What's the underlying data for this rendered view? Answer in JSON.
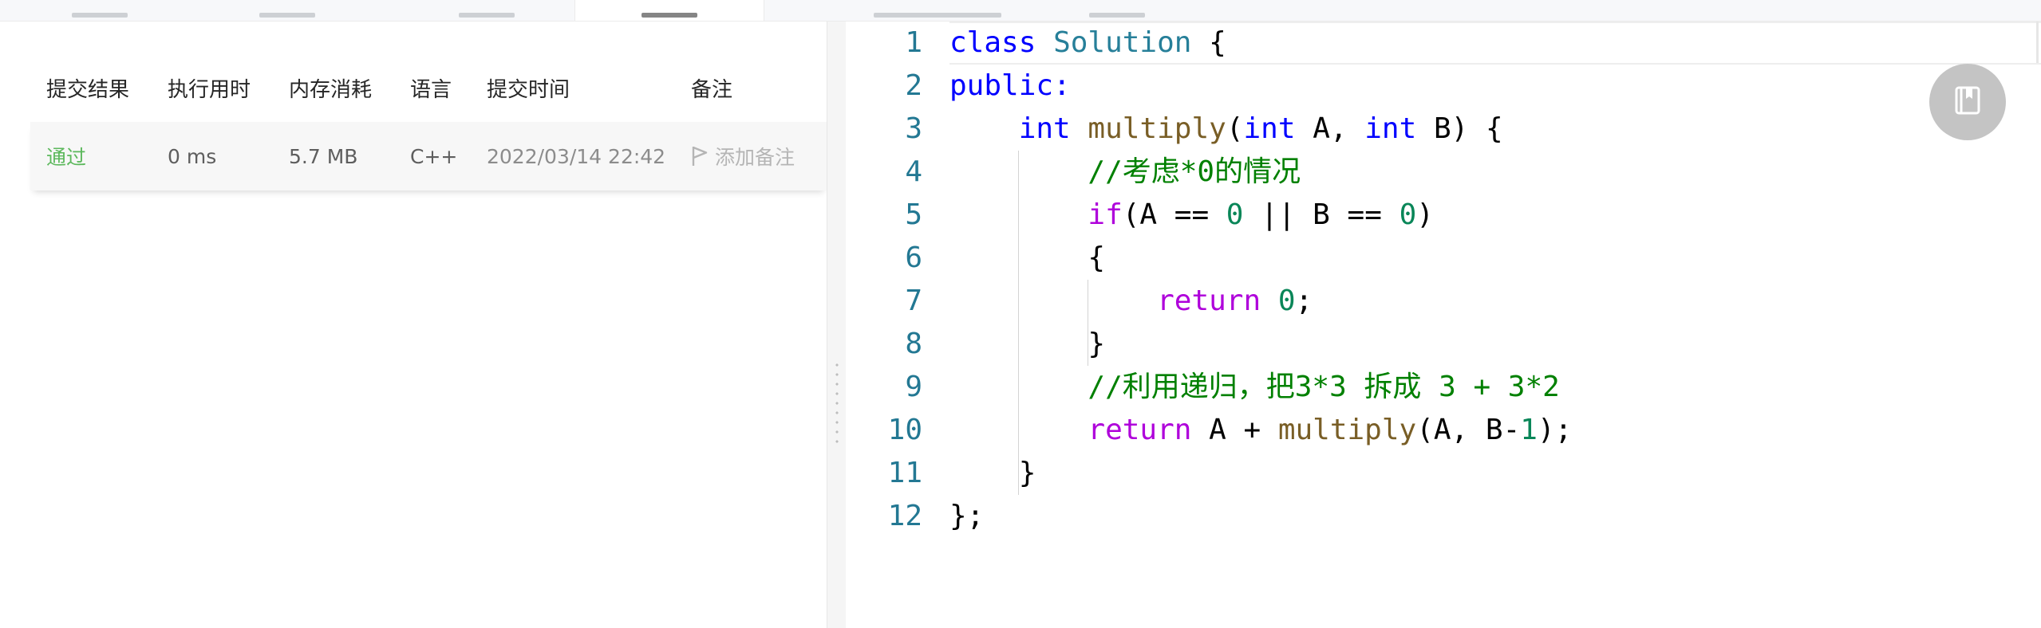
{
  "submissions": {
    "headers": {
      "result": "提交结果",
      "runtime": "执行用时",
      "memory": "内存消耗",
      "language": "语言",
      "submit_time": "提交时间",
      "note": "备注"
    },
    "rows": [
      {
        "result": "通过",
        "runtime": "0 ms",
        "memory": "5.7 MB",
        "language": "C++",
        "submit_time": "2022/03/14 22:42",
        "note_action": "添加备注"
      }
    ]
  },
  "editor": {
    "line_numbers": [
      "1",
      "2",
      "3",
      "4",
      "5",
      "6",
      "7",
      "8",
      "9",
      "10",
      "11",
      "12"
    ],
    "tokens": {
      "l1_kw": "class",
      "l1_ty": "Solution",
      "l1_rest": " {",
      "l2_kw": "public:",
      "l3_kw1": "int",
      "l3_fn": "multiply",
      "l3_p1": "(",
      "l3_kw2": "int",
      "l3_a": " A, ",
      "l3_kw3": "int",
      "l3_b": " B) {",
      "l4_cm": "//考虑*0的情况",
      "l5_ctl": "if",
      "l5_a": "(A == ",
      "l5_n1": "0",
      "l5_b": " || B == ",
      "l5_n2": "0",
      "l5_c": ")",
      "l6": "{",
      "l7_ctl": "return",
      "l7_sp": " ",
      "l7_num": "0",
      "l7_end": ";",
      "l8": "}",
      "l9_cm": "//利用递归，把3*3 拆成 3 + 3*2",
      "l10_ctl": "return",
      "l10_a": " A + ",
      "l10_fn": "multiply",
      "l10_b": "(A, B-",
      "l10_num": "1",
      "l10_c": ");",
      "l11": "}",
      "l12": "};"
    }
  },
  "colors": {
    "pass_green": "#5cb85c",
    "line_number": "#237893",
    "keyword": "#0000ff",
    "type": "#267f99",
    "function": "#795e26",
    "control": "#af00db",
    "number": "#098658",
    "comment": "#008000"
  },
  "icons": {
    "note_action": "flag-icon",
    "fab": "notebook-icon"
  }
}
